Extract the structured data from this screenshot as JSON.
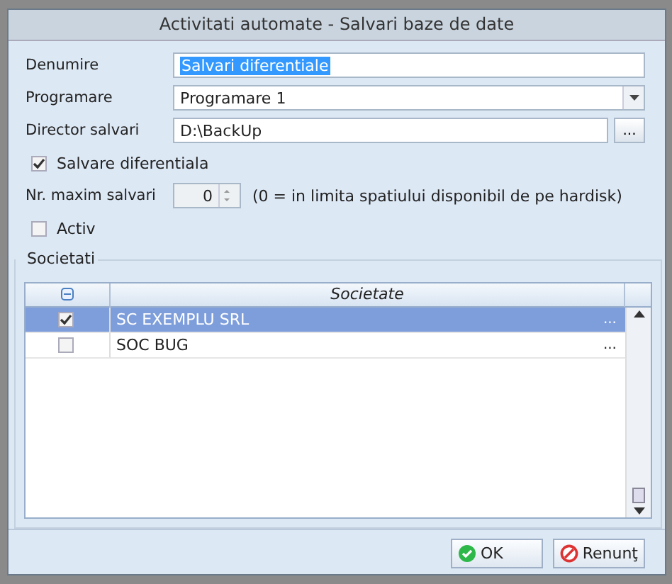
{
  "window": {
    "title": "Activitati automate - Salvari baze de date"
  },
  "rows": [
    {
      "kind": "text",
      "label": "Denumire",
      "value": "Salvari diferentiale",
      "text_selected": true
    },
    {
      "kind": "dropdown",
      "label": "Programare",
      "value": "Programare 1"
    },
    {
      "kind": "browse",
      "label": "Director salvari",
      "value": "D:\\BackUp",
      "button": "..."
    },
    {
      "kind": "checkbox",
      "label": "Salvare diferentiala",
      "checked": true
    },
    {
      "kind": "spin",
      "label": "Nr. maxim salvari",
      "value": "0",
      "hint": "(0 = in limita spatiului disponibil de pe hardisk)"
    },
    {
      "kind": "checkbox",
      "label": "Activ",
      "checked": false
    }
  ],
  "group": {
    "title": "Societati",
    "columns": [
      "Societate"
    ],
    "rows": [
      {
        "name": "SC EXEMPLU SRL",
        "checked": true,
        "selected": true,
        "action": "..."
      },
      {
        "name": "SOC BUG",
        "checked": false,
        "selected": false,
        "action": "..."
      }
    ]
  },
  "buttons": [
    {
      "kind": "ok",
      "label": "OK"
    },
    {
      "kind": "cancel",
      "label": "Renunţ"
    }
  ]
}
